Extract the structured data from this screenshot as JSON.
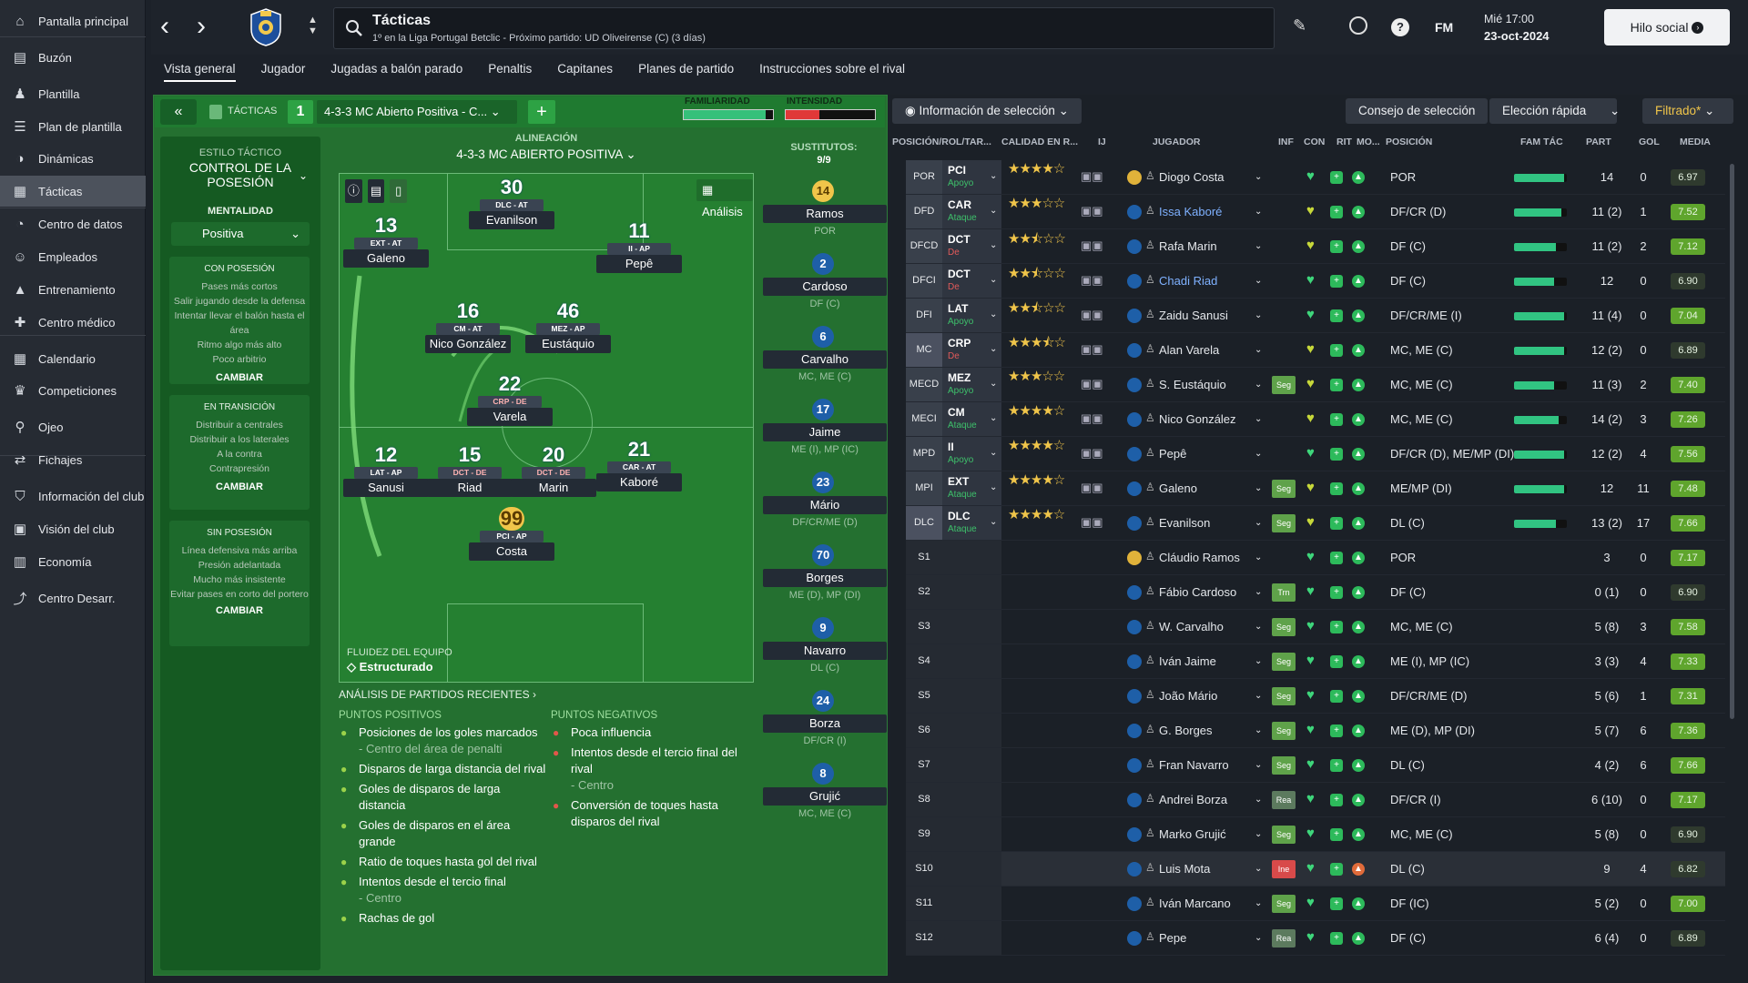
{
  "sidebar": {
    "items": [
      {
        "label": "Pantalla principal",
        "icon": "home-icon"
      },
      {
        "label": "Buzón",
        "icon": "inbox-icon"
      },
      {
        "label": "Plantilla",
        "icon": "squad-icon"
      },
      {
        "label": "Plan de plantilla",
        "icon": "squad-plan-icon"
      },
      {
        "label": "Dinámicas",
        "icon": "dynamics-icon"
      },
      {
        "label": "Tácticas",
        "icon": "tactics-icon"
      },
      {
        "label": "Centro de datos",
        "icon": "data-icon"
      },
      {
        "label": "Empleados",
        "icon": "staff-icon"
      },
      {
        "label": "Entrenamiento",
        "icon": "training-icon"
      },
      {
        "label": "Centro médico",
        "icon": "medical-icon"
      },
      {
        "label": "Calendario",
        "icon": "calendar-icon"
      },
      {
        "label": "Competiciones",
        "icon": "trophy-icon"
      },
      {
        "label": "Ojeo",
        "icon": "scouting-icon"
      },
      {
        "label": "Fichajes",
        "icon": "transfers-icon"
      },
      {
        "label": "Información del club",
        "icon": "club-info-icon"
      },
      {
        "label": "Visión del club",
        "icon": "club-vision-icon"
      },
      {
        "label": "Economía",
        "icon": "finances-icon"
      },
      {
        "label": "Centro Desarr.",
        "icon": "dev-centre-icon"
      }
    ]
  },
  "header": {
    "title": "Tácticas",
    "subtitle": "1º en la Liga Portugal Betclic - Próximo partido: UD Oliveirense (C) (3 días)",
    "fm": "FM",
    "date_line1": "Mié 17:00",
    "date_line2": "23-oct-2024",
    "social_button": "Hilo social"
  },
  "tabs": [
    "Vista general",
    "Jugador",
    "Jugadas a balón parado",
    "Penaltis",
    "Capitanes",
    "Planes de partido",
    "Instrucciones sobre el rival"
  ],
  "tactic_bar": {
    "tacticas_label": "TÁCTICAS",
    "slot": "1",
    "formation": "4-3-3 MC Abierto Positiva - C...",
    "familiaridad_label": "FAMILIARIDAD",
    "intensidad_label": "INTENSIDAD",
    "familiaridad_value": 0.92,
    "intensidad_value": 0.38
  },
  "style": {
    "estilo_label": "ESTILO TÁCTICO",
    "estilo_value": "CONTROL DE LA POSESIÓN",
    "mentalidad_label": "MENTALIDAD",
    "mentalidad_value": "Positiva",
    "con_posesion": {
      "title": "CON POSESIÓN",
      "lines": [
        "Pases más cortos",
        "Salir jugando desde la defensa",
        "Intentar llevar el balón hasta el área",
        "Ritmo algo más alto",
        "Poco arbitrio"
      ]
    },
    "transicion": {
      "title": "EN TRANSICIÓN",
      "lines": [
        "Distribuir a centrales",
        "Distribuir a los laterales",
        "A la contra",
        "Contrapresión"
      ]
    },
    "sin_posesion": {
      "title": "SIN POSESIÓN",
      "lines": [
        "Línea defensiva más arriba",
        "Presión adelantada",
        "Mucho más insistente",
        "Evitar pases en corto del portero"
      ]
    },
    "cambiar": "CAMBIAR"
  },
  "pitch": {
    "alineacion_label": "ALINEACIÓN",
    "alineacion_value": "4-3-3 MC ABIERTO POSITIVA",
    "analisis": "Análisis",
    "fluidez_label": "FLUIDEZ DEL EQUIPO",
    "fluidez_value": "Estructurado",
    "players": [
      {
        "num": "30",
        "role": "DLC - AT",
        "name": "Evanilson"
      },
      {
        "num": "13",
        "role": "EXT - AT",
        "name": "Galeno"
      },
      {
        "num": "11",
        "role": "II - AP",
        "name": "Pepê"
      },
      {
        "num": "16",
        "role": "CM - AT",
        "name": "Nico González"
      },
      {
        "num": "46",
        "role": "MEZ - AP",
        "name": "Eustáquio"
      },
      {
        "num": "22",
        "role": "CRP - DE",
        "name": "Varela"
      },
      {
        "num": "12",
        "role": "LAT - AP",
        "name": "Sanusi"
      },
      {
        "num": "15",
        "role": "DCT - DE",
        "name": "Riad"
      },
      {
        "num": "20",
        "role": "DCT - DE",
        "name": "Marin"
      },
      {
        "num": "21",
        "role": "CAR - AT",
        "name": "Kaboré"
      },
      {
        "num": "99",
        "role": "PCI - AP",
        "name": "Costa"
      }
    ]
  },
  "subs": {
    "label": "SUSTITUTOS:",
    "count": "9/9",
    "items": [
      {
        "num": "14",
        "name": "Ramos",
        "pos": "POR"
      },
      {
        "num": "2",
        "name": "Cardoso",
        "pos": "DF (C)"
      },
      {
        "num": "6",
        "name": "Carvalho",
        "pos": "MC, ME (C)"
      },
      {
        "num": "17",
        "name": "Jaime",
        "pos": "ME (I), MP (IC)"
      },
      {
        "num": "23",
        "name": "Mário",
        "pos": "DF/CR/ME (D)"
      },
      {
        "num": "70",
        "name": "Borges",
        "pos": "ME (D), MP (DI)"
      },
      {
        "num": "9",
        "name": "Navarro",
        "pos": "DL (C)"
      },
      {
        "num": "24",
        "name": "Borza",
        "pos": "DF/CR (I)"
      },
      {
        "num": "8",
        "name": "Grujić",
        "pos": "MC, ME (C)"
      }
    ]
  },
  "analysis": {
    "title": "ANÁLISIS DE PARTIDOS RECIENTES",
    "pos_title": "PUNTOS POSITIVOS",
    "neg_title": "PUNTOS NEGATIVOS",
    "positives": [
      {
        "text": "Posiciones de los goles marcados",
        "sub": "- Centro del área de penalti"
      },
      {
        "text": "Disparos de larga distancia del rival",
        "sub": ""
      },
      {
        "text": "Goles de disparos de larga distancia",
        "sub": ""
      },
      {
        "text": "Goles de disparos en el área grande",
        "sub": ""
      },
      {
        "text": "Ratio de toques hasta gol del rival",
        "sub": ""
      },
      {
        "text": "Intentos desde el tercio final",
        "sub": "- Centro"
      },
      {
        "text": "Rachas de gol",
        "sub": ""
      }
    ],
    "negatives": [
      {
        "text": "Poca influencia",
        "sub": ""
      },
      {
        "text": "Intentos desde el tercio final del rival",
        "sub": "- Centro"
      },
      {
        "text": "Conversión de toques hasta disparos del rival",
        "sub": ""
      }
    ]
  },
  "right": {
    "info_btn": "Información de selección",
    "consejo_btn": "Consejo de selección",
    "eleccion_btn": "Elección rápida",
    "filtrado_btn": "Filtrado*",
    "headers": [
      "POSICIÓN/ROL/TAR...",
      "CALIDAD EN R...",
      "IJ",
      "JUGADOR",
      "INF",
      "CON",
      "RIT",
      "MO...",
      "POSICIÓN",
      "FAM TÁC",
      "PART",
      "GOL",
      "MEDIA"
    ],
    "rows": [
      {
        "pos": "POR",
        "role": "PCI",
        "duty": "Apoyo",
        "stars": 4,
        "name": "Diogo Costa",
        "inf": "",
        "posn": "POR",
        "fam": 0.95,
        "part": "14",
        "gol": "0",
        "media": "6.97"
      },
      {
        "pos": "DFD",
        "role": "CAR",
        "duty": "Ataque",
        "stars": 3,
        "name": "Issa Kaboré",
        "inf": "",
        "posn": "DF/CR (D)",
        "fam": 0.9,
        "part": "11 (2)",
        "gol": "1",
        "media": "7.52"
      },
      {
        "pos": "DFCD",
        "role": "DCT",
        "duty": "De",
        "stars": 2.5,
        "name": "Rafa Marin",
        "inf": "",
        "posn": "DF (C)",
        "fam": 0.8,
        "part": "11 (2)",
        "gol": "2",
        "media": "7.12"
      },
      {
        "pos": "DFCI",
        "role": "DCT",
        "duty": "De",
        "stars": 2.5,
        "name": "Chadi Riad",
        "inf": "",
        "posn": "DF (C)",
        "fam": 0.75,
        "part": "12",
        "gol": "0",
        "media": "6.90"
      },
      {
        "pos": "DFI",
        "role": "LAT",
        "duty": "Apoyo",
        "stars": 2.5,
        "name": "Zaidu Sanusi",
        "inf": "",
        "posn": "DF/CR/ME (I)",
        "fam": 0.95,
        "part": "11 (4)",
        "gol": "0",
        "media": "7.04"
      },
      {
        "pos": "MC",
        "role": "CRP",
        "duty": "De",
        "stars": 3.5,
        "name": "Alan Varela",
        "inf": "",
        "posn": "MC, ME (C)",
        "fam": 0.95,
        "part": "12 (2)",
        "gol": "0",
        "media": "6.89"
      },
      {
        "pos": "MECD",
        "role": "MEZ",
        "duty": "Apoyo",
        "stars": 3,
        "name": "S. Eustáquio",
        "inf": "Seg",
        "posn": "MC, ME (C)",
        "fam": 0.75,
        "part": "11 (3)",
        "gol": "2",
        "media": "7.40"
      },
      {
        "pos": "MECI",
        "role": "CM",
        "duty": "Ataque",
        "stars": 4,
        "name": "Nico González",
        "inf": "",
        "posn": "MC, ME (C)",
        "fam": 0.85,
        "part": "14 (2)",
        "gol": "3",
        "media": "7.26"
      },
      {
        "pos": "MPD",
        "role": "II",
        "duty": "Apoyo",
        "stars": 4,
        "name": "Pepê",
        "inf": "",
        "posn": "DF/CR (D), ME/MP (DI)",
        "fam": 0.95,
        "part": "12 (2)",
        "gol": "4",
        "media": "7.56"
      },
      {
        "pos": "MPI",
        "role": "EXT",
        "duty": "Ataque",
        "stars": 4,
        "name": "Galeno",
        "inf": "Seg",
        "posn": "ME/MP (DI)",
        "fam": 0.95,
        "part": "12",
        "gol": "11",
        "media": "7.48"
      },
      {
        "pos": "DLC",
        "role": "DLC",
        "duty": "Ataque",
        "stars": 4,
        "name": "Evanilson",
        "inf": "Seg",
        "posn": "DL (C)",
        "fam": 0.8,
        "part": "13 (2)",
        "gol": "17",
        "media": "7.66"
      },
      {
        "pos": "S1",
        "role": "",
        "duty": "",
        "stars": 0,
        "name": "Cláudio Ramos",
        "inf": "",
        "posn": "POR",
        "fam": 0,
        "part": "3",
        "gol": "0",
        "media": "7.17"
      },
      {
        "pos": "S2",
        "role": "",
        "duty": "",
        "stars": 0,
        "name": "Fábio Cardoso",
        "inf": "Trn",
        "posn": "DF (C)",
        "fam": 0,
        "part": "0 (1)",
        "gol": "0",
        "media": "6.90"
      },
      {
        "pos": "S3",
        "role": "",
        "duty": "",
        "stars": 0,
        "name": "W. Carvalho",
        "inf": "Seg",
        "posn": "MC, ME (C)",
        "fam": 0,
        "part": "5 (8)",
        "gol": "3",
        "media": "7.58"
      },
      {
        "pos": "S4",
        "role": "",
        "duty": "",
        "stars": 0,
        "name": "Iván Jaime",
        "inf": "Seg",
        "posn": "ME (I), MP (IC)",
        "fam": 0,
        "part": "3 (3)",
        "gol": "4",
        "media": "7.33"
      },
      {
        "pos": "S5",
        "role": "",
        "duty": "",
        "stars": 0,
        "name": "João Mário",
        "inf": "Seg",
        "posn": "DF/CR/ME (D)",
        "fam": 0,
        "part": "5 (6)",
        "gol": "1",
        "media": "7.31"
      },
      {
        "pos": "S6",
        "role": "",
        "duty": "",
        "stars": 0,
        "name": "G. Borges",
        "inf": "Seg",
        "posn": "ME (D), MP (DI)",
        "fam": 0,
        "part": "5 (7)",
        "gol": "6",
        "media": "7.36"
      },
      {
        "pos": "S7",
        "role": "",
        "duty": "",
        "stars": 0,
        "name": "Fran Navarro",
        "inf": "Seg",
        "posn": "DL (C)",
        "fam": 0,
        "part": "4 (2)",
        "gol": "6",
        "media": "7.66"
      },
      {
        "pos": "S8",
        "role": "",
        "duty": "",
        "stars": 0,
        "name": "Andrei Borza",
        "inf": "Rea",
        "posn": "DF/CR (I)",
        "fam": 0,
        "part": "6 (10)",
        "gol": "0",
        "media": "7.17"
      },
      {
        "pos": "S9",
        "role": "",
        "duty": "",
        "stars": 0,
        "name": "Marko Grujić",
        "inf": "Seg",
        "posn": "MC, ME (C)",
        "fam": 0,
        "part": "5 (8)",
        "gol": "0",
        "media": "6.90"
      },
      {
        "pos": "S10",
        "role": "",
        "duty": "",
        "stars": 0,
        "name": "Luis Mota",
        "inf": "Ine",
        "posn": "DL (C)",
        "fam": 0,
        "part": "9",
        "gol": "4",
        "media": "6.82"
      },
      {
        "pos": "S11",
        "role": "",
        "duty": "",
        "stars": 0,
        "name": "Iván Marcano",
        "inf": "Seg",
        "posn": "DF (IC)",
        "fam": 0,
        "part": "5 (2)",
        "gol": "0",
        "media": "7.00"
      },
      {
        "pos": "S12",
        "role": "",
        "duty": "",
        "stars": 0,
        "name": "Pepe",
        "inf": "Rea",
        "posn": "DF (C)",
        "fam": 0,
        "part": "6 (4)",
        "gol": "0",
        "media": "6.89"
      }
    ]
  },
  "colors": {
    "green_panel": "#247030",
    "media_high": "#5fa52d",
    "media_low": "#2f3a2e",
    "inf_seg": "#5fa24a",
    "inf_ine": "#d84a4a"
  }
}
